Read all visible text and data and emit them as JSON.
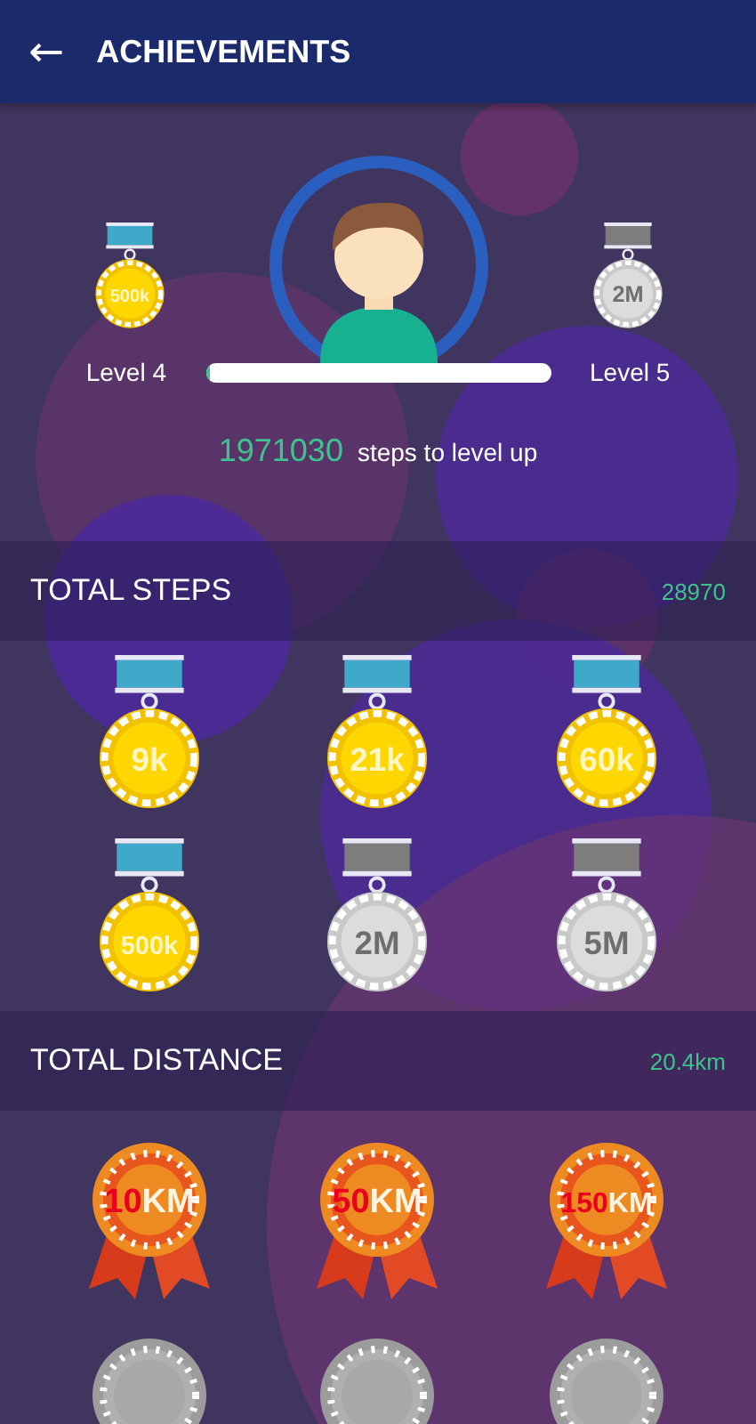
{
  "header": {
    "back_icon": "←",
    "title": "ACHIEVEMENTS"
  },
  "profile": {
    "current_medal": {
      "label": "500k",
      "earned": true
    },
    "current_level": "Level 4",
    "next_medal": {
      "label": "2M",
      "earned": false
    },
    "next_level": "Level 5",
    "level": 0.015,
    "steps_remaining": "1971030",
    "steps_text": "steps to level up"
  },
  "sections": [
    {
      "title": "TOTAL STEPS",
      "value": "28970",
      "kind": "steps",
      "medals": [
        {
          "label": "9k",
          "earned": true
        },
        {
          "label": "21k",
          "earned": true
        },
        {
          "label": "60k",
          "earned": true
        },
        {
          "label": "500k",
          "earned": true
        },
        {
          "label": "2M",
          "earned": false
        },
        {
          "label": "5M",
          "earned": false
        }
      ]
    },
    {
      "title": "TOTAL DISTANCE",
      "value": "20.4km",
      "kind": "distance",
      "medals": [
        {
          "amount": "10",
          "unit": "KM",
          "earned": true
        },
        {
          "amount": "50",
          "unit": "KM",
          "earned": true
        },
        {
          "amount": "150",
          "unit": "KM",
          "earned": true
        },
        {
          "earned": false
        },
        {
          "earned": false
        },
        {
          "earned": false
        }
      ]
    }
  ]
}
